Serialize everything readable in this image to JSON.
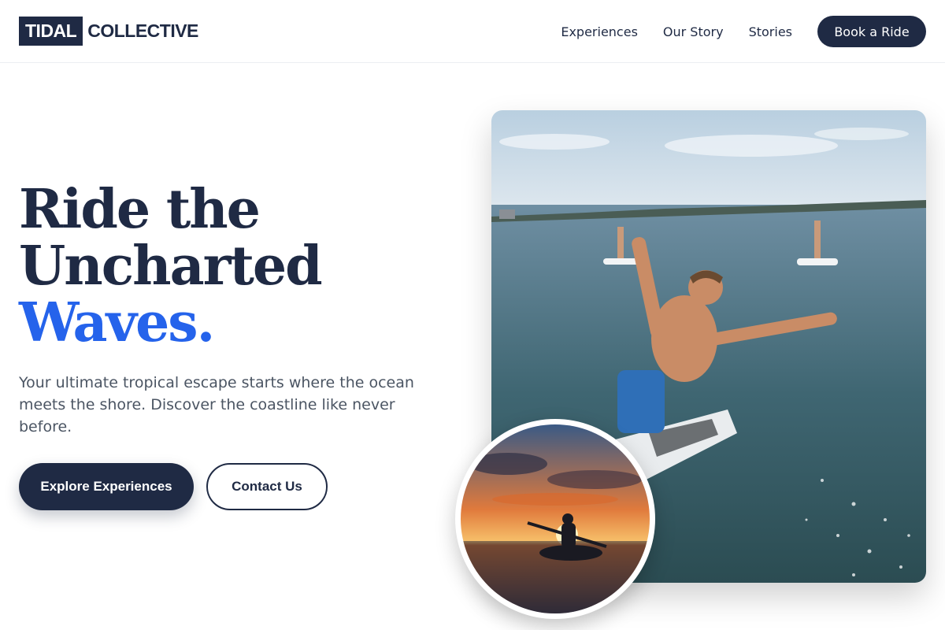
{
  "brand": {
    "logo_boxed": "TIDAL",
    "logo_text": "COLLECTIVE",
    "primary_color": "#1f2a44",
    "accent_color": "#2563eb"
  },
  "nav": {
    "links": [
      "Experiences",
      "Our Story",
      "Stories"
    ],
    "cta": "Book a Ride"
  },
  "hero": {
    "title_line1": "Ride the",
    "title_line2": "Uncharted",
    "title_accent": "Waves.",
    "subtitle": "Your ultimate tropical escape starts where the ocean meets the shore. Discover the coastline like never before.",
    "primary_button": "Explore Experiences",
    "secondary_button": "Contact Us"
  },
  "images": {
    "main_photo": "paddleboarder-jumping-photo",
    "inset_photo": "sunset-kayak-photo"
  }
}
